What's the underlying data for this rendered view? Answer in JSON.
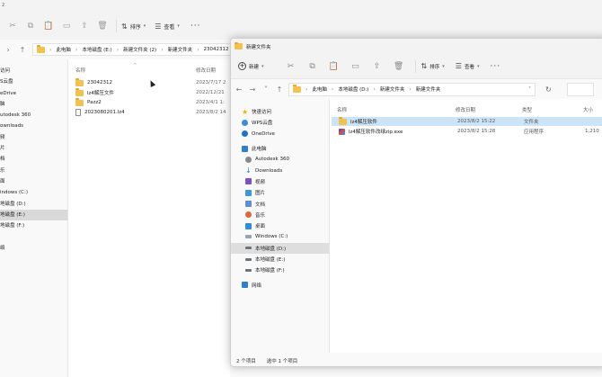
{
  "bg": {
    "title_fragment": "2",
    "toolbar": {
      "sort": "排序",
      "view": "查看"
    },
    "crumbs": [
      "此电脑",
      "本地磁盘 (E:)",
      "新建文件夹 (2)",
      "新建文件夹",
      "23042312"
    ],
    "nav": [
      "访问",
      "S云盘",
      "eDrive",
      "脑",
      "utodesk 360",
      "ownloads",
      "频",
      "片",
      "档",
      "乐",
      "面",
      "indows (C:)",
      "地磁盘 (D:)",
      "地磁盘 (E:)",
      "地磁盘 (F:)",
      "",
      "络"
    ],
    "columns": {
      "name": "名称",
      "modified": "修改日期"
    },
    "files": [
      {
        "name": "23042312",
        "date": "2023/7/17 2",
        "kind": "folder"
      },
      {
        "name": "lz4解压文件",
        "date": "2022/12/21",
        "kind": "folder"
      },
      {
        "name": "Pazz2",
        "date": "2023/4/1 1:",
        "kind": "folder"
      },
      {
        "name": "2023080201.lz4",
        "date": "2023/8/2 14",
        "kind": "file"
      }
    ]
  },
  "fw": {
    "title": "新建文件夹",
    "toolbar": {
      "new": "新建",
      "sort": "排序",
      "view": "查看"
    },
    "crumbs": [
      "此电脑",
      "本地磁盘 (D:)",
      "新建文件夹",
      "新建文件夹"
    ],
    "nav": {
      "quick_access": "快速访问",
      "wps": "WPS云盘",
      "onedrive": "OneDrive",
      "this_pc": "此电脑",
      "items": [
        "Autodesk 360",
        "Downloads",
        "视频",
        "图片",
        "文档",
        "音乐",
        "桌面",
        "Windows (C:)",
        "本地磁盘 (D:)",
        "本地磁盘 (E:)",
        "本地磁盘 (F:)"
      ],
      "network": "网络"
    },
    "columns": {
      "name": "名称",
      "modified": "修改日期",
      "type": "类型",
      "size": "大小"
    },
    "files": [
      {
        "name": "lz4解压软件",
        "date": "2023/8/2 15:22",
        "type": "文件夹",
        "size": ""
      },
      {
        "name": "lz4解压软件改绿zip.exe",
        "date": "2023/8/2 15:28",
        "type": "应用程序",
        "size": "1,210"
      }
    ],
    "status": {
      "count": "2 个项目",
      "selected": "选中 1 个项目"
    }
  },
  "colors": {
    "selection": "#cce4f7",
    "folder": "#f2c14e",
    "accent": "#0078d4"
  }
}
